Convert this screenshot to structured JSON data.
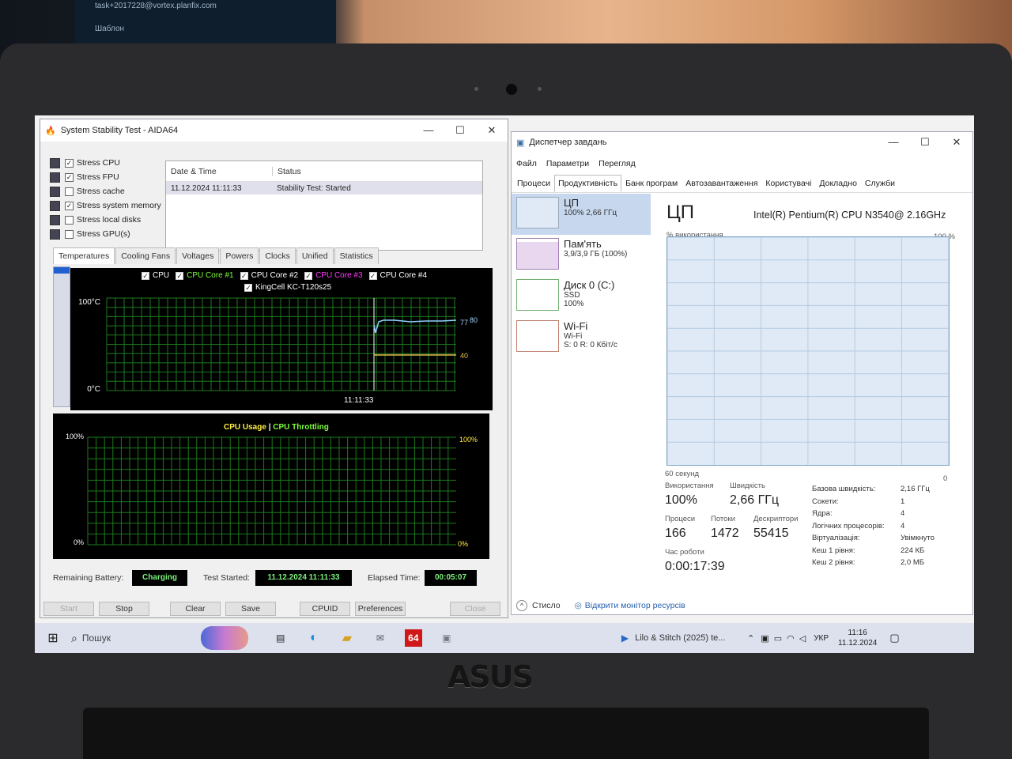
{
  "background": {
    "monitor_email": "task+2017228@vortex.planfix.com",
    "monitor_text": "Шаблон"
  },
  "laptop": {
    "brand": "ASUS"
  },
  "aida": {
    "title": "System Stability Test - AIDA64",
    "stress_items": [
      {
        "label": "Stress CPU",
        "checked": true
      },
      {
        "label": "Stress FPU",
        "checked": true
      },
      {
        "label": "Stress cache",
        "checked": false
      },
      {
        "label": "Stress system memory",
        "checked": true
      },
      {
        "label": "Stress local disks",
        "checked": false
      },
      {
        "label": "Stress GPU(s)",
        "checked": false
      }
    ],
    "log": {
      "col_date": "Date & Time",
      "col_status": "Status",
      "rows": [
        {
          "date": "11.12.2024 11:11:33",
          "status": "Stability Test: Started"
        }
      ]
    },
    "tabs": [
      "Temperatures",
      "Cooling Fans",
      "Voltages",
      "Powers",
      "Clocks",
      "Unified",
      "Statistics"
    ],
    "temp_graph": {
      "legend": [
        "CPU",
        "CPU Core #1",
        "CPU Core #2",
        "CPU Core #3",
        "CPU Core #4",
        "KingCell KC-T120s25"
      ],
      "legend_colors": [
        "#ffffff",
        "#7cff3a",
        "#ffffff",
        "#ff3aff",
        "#ffffff",
        "#ffffff"
      ],
      "y_top": "100°C",
      "y_bottom": "0°C",
      "time": "11:11:33",
      "v1": "77",
      "v2": "80",
      "v3": "40"
    },
    "usage_graph": {
      "label1": "CPU Usage",
      "sep": "|",
      "label2": "CPU Throttling",
      "y_top": "100%",
      "y_bottom": "0%",
      "r_top": "100%",
      "r_bottom": "0%"
    },
    "status_bar": {
      "battery_label": "Remaining Battery:",
      "battery_value": "Charging",
      "started_label": "Test Started:",
      "started_value": "11.12.2024 11:11:33",
      "elapsed_label": "Elapsed Time:",
      "elapsed_value": "00:05:07"
    },
    "buttons": {
      "start": "Start",
      "stop": "Stop",
      "clear": "Clear",
      "save": "Save",
      "cpuid": "CPUID",
      "preferences": "Preferences",
      "close": "Close"
    }
  },
  "tm": {
    "title": "Диспетчер завдань",
    "menu": [
      "Файл",
      "Параметри",
      "Перегляд"
    ],
    "tabs": [
      "Процеси",
      "Продуктивність",
      "Банк програм",
      "Автозавантаження",
      "Користувачі",
      "Докладно",
      "Служби"
    ],
    "perf_items": [
      {
        "title": "ЦП",
        "sub1": "100% 2,66 ГГц",
        "sub2": "",
        "sub3": ""
      },
      {
        "title": "Пам'ять",
        "sub1": "3,9/3,9 ГБ (100%)",
        "sub2": "",
        "sub3": ""
      },
      {
        "title": "Диск 0 (C:)",
        "sub1": "SSD",
        "sub2": "100%",
        "sub3": ""
      },
      {
        "title": "Wi-Fi",
        "sub1": "Wi-Fi",
        "sub2": "S: 0 R: 0 Кбіт/с",
        "sub3": ""
      }
    ],
    "cpu": {
      "heading": "ЦП",
      "model": "Intel(R) Pentium(R) CPU N3540@ 2.16GHz",
      "y_label": "% використання",
      "y_max": "100 %",
      "x_label": "60 секунд",
      "x_min": "0"
    },
    "stats": {
      "usage_label": "Використання",
      "usage": "100%",
      "speed_label": "Швидкість",
      "speed": "2,66 ГГц",
      "proc_label": "Процеси",
      "proc": "166",
      "threads_label": "Потоки",
      "threads": "1472",
      "handles_label": "Дескриптори",
      "handles": "55415",
      "uptime_label": "Час роботи",
      "uptime": "0:00:17:39"
    },
    "details": [
      {
        "k": "Базова швидкість:",
        "v": "2,16 ГГц"
      },
      {
        "k": "Сокети:",
        "v": "1"
      },
      {
        "k": "Ядра:",
        "v": "4"
      },
      {
        "k": "Логічних процесорів:",
        "v": "4"
      },
      {
        "k": "Віртуалізація:",
        "v": "Увімкнуто"
      },
      {
        "k": "Кеш 1 рівня:",
        "v": "224 КБ"
      },
      {
        "k": "Кеш 2 рівня:",
        "v": "2,0 МБ"
      }
    ],
    "footer": {
      "compact": "Стисло",
      "monitor": "Відкрити монітор ресурсів"
    }
  },
  "taskbar": {
    "search": "Пошук",
    "media": "Lilo & Stitch (2025) te...",
    "lang": "УКР",
    "time": "11:16",
    "date": "11.12.2024",
    "aida_badge": "64"
  }
}
